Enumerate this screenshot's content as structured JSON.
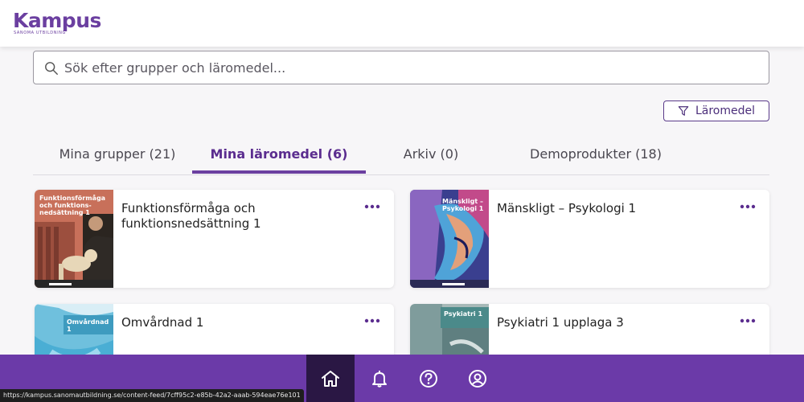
{
  "header": {
    "logo_text": "Kampus",
    "logo_sub": "SANOMA UTBILDNING"
  },
  "search": {
    "placeholder": "Sök efter grupper och läromedel..."
  },
  "filter": {
    "label": "Läromedel",
    "icon": "filter-icon"
  },
  "tabs": [
    {
      "label": "Mina grupper (21)",
      "active": false
    },
    {
      "label": "Mina läromedel (6)",
      "active": true
    },
    {
      "label": "Arkiv (0)",
      "active": false
    },
    {
      "label": "Demoprodukter (18)",
      "active": false
    }
  ],
  "cards": [
    {
      "title": "Funktionsförmåga och funktionsnedsättning 1",
      "cover_text": "Funktionsförmåga och funktions-nedsättning 1",
      "cover_color": "#c8705a"
    },
    {
      "title": "Mänskligt – Psykologi 1",
      "cover_text": "Mänskligt – Psykologi 1",
      "cover_color": "#7d5fb5"
    },
    {
      "title": "Omvårdnad 1",
      "cover_text": "Omvårdnad 1",
      "cover_color": "#3e9bbf"
    },
    {
      "title": "Psykiatri 1 upplaga 3",
      "cover_text": "Psykiatri 1",
      "cover_color": "#4b8a8a"
    }
  ],
  "bottom_nav": [
    {
      "icon": "home-icon",
      "active": true
    },
    {
      "icon": "bell-icon",
      "active": false
    },
    {
      "icon": "help-icon",
      "active": false
    },
    {
      "icon": "user-icon",
      "active": false
    }
  ],
  "status_bar": {
    "url": "https://kampus.sanomautbildning.se/content-feed/7cff95c2-e85b-42a2-aaab-594eae76e101"
  },
  "colors": {
    "brand": "#6b3fa0",
    "nav_bg": "#6b3aa8",
    "nav_active": "#2a1744"
  }
}
